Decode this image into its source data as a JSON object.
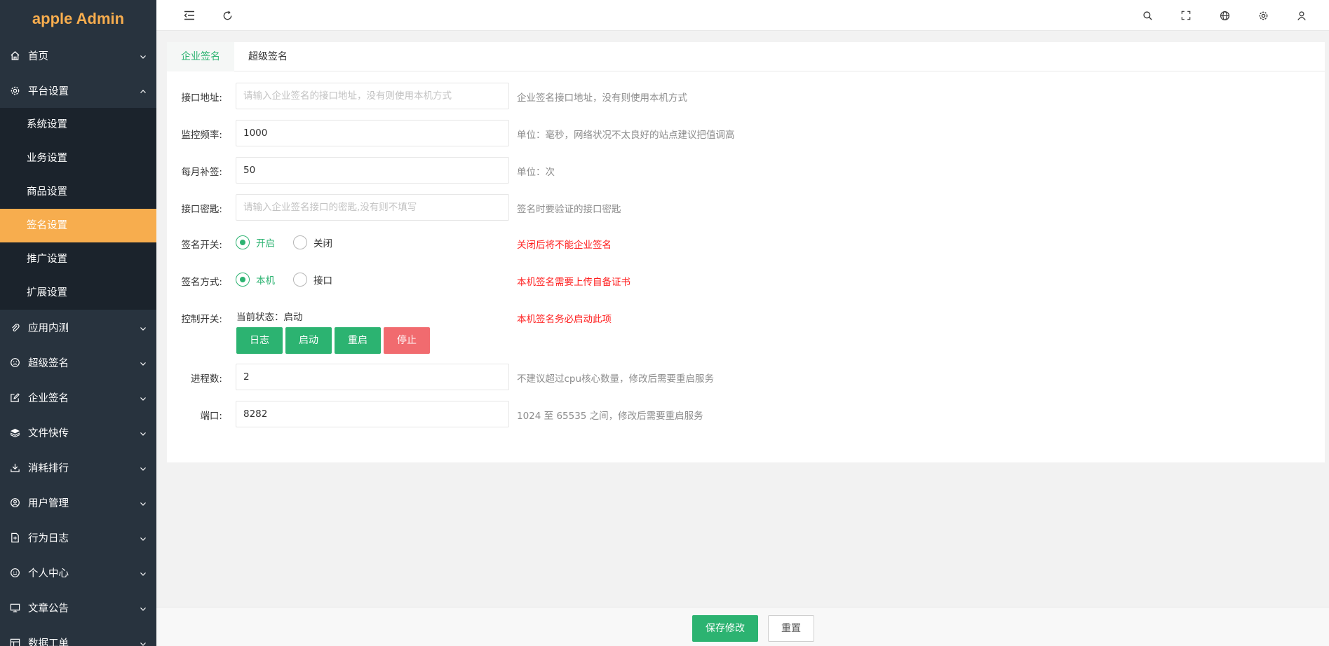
{
  "app": {
    "title": "apple Admin"
  },
  "sidebar": {
    "items": [
      {
        "label": "首页",
        "icon": "home-icon"
      },
      {
        "label": "平台设置",
        "icon": "gear-icon",
        "expanded": true,
        "children": [
          {
            "label": "系统设置"
          },
          {
            "label": "业务设置"
          },
          {
            "label": "商品设置"
          },
          {
            "label": "签名设置",
            "active": true
          },
          {
            "label": "推广设置"
          },
          {
            "label": "扩展设置"
          }
        ]
      },
      {
        "label": "应用内测",
        "icon": "paperclip-icon"
      },
      {
        "label": "超级签名",
        "icon": "face-icon"
      },
      {
        "label": "企业签名",
        "icon": "edit-icon"
      },
      {
        "label": "文件快传",
        "icon": "layers-icon"
      },
      {
        "label": "消耗排行",
        "icon": "download-icon"
      },
      {
        "label": "用户管理",
        "icon": "user-circle-icon"
      },
      {
        "label": "行为日志",
        "icon": "document-icon"
      },
      {
        "label": "个人中心",
        "icon": "smile-icon"
      },
      {
        "label": "文章公告",
        "icon": "monitor-icon"
      },
      {
        "label": "数据工单",
        "icon": "table-icon"
      }
    ]
  },
  "tabs": [
    {
      "label": "企业签名",
      "active": true
    },
    {
      "label": "超级签名"
    }
  ],
  "form": {
    "api_address": {
      "label": "接口地址:",
      "value": "",
      "placeholder": "请输入企业签名的接口地址，没有则使用本机方式",
      "help": "企业签名接口地址，没有则使用本机方式"
    },
    "monitor_freq": {
      "label": "监控频率:",
      "value": "1000",
      "help": "单位：毫秒，网络状况不太良好的站点建议把值调高"
    },
    "monthly_resign": {
      "label": "每月补签:",
      "value": "50",
      "help": "单位：次"
    },
    "api_key": {
      "label": "接口密匙:",
      "value": "",
      "placeholder": "请输入企业签名接口的密匙,没有则不填写",
      "help": "签名时要验证的接口密匙"
    },
    "sign_switch": {
      "label": "签名开关:",
      "on_label": "开启",
      "off_label": "关闭",
      "selected": "开启",
      "help": "关闭后将不能企业签名"
    },
    "sign_mode": {
      "label": "签名方式:",
      "local_label": "本机",
      "api_label": "接口",
      "selected": "本机",
      "help": "本机签名需要上传自备证书"
    },
    "control": {
      "label": "控制开关:",
      "status": "当前状态：启动",
      "buttons": [
        "日志",
        "启动",
        "重启",
        "停止"
      ],
      "help": "本机签名务必启动此项"
    },
    "processes": {
      "label": "进程数:",
      "value": "2",
      "help": "不建议超过cpu核心数量，修改后需要重启服务"
    },
    "port": {
      "label": "端口:",
      "value": "8282",
      "help": "1024 至 65535 之间，修改后需要重启服务"
    }
  },
  "footer": {
    "save_label": "保存修改",
    "reset_label": "重置"
  },
  "colors": {
    "accent": "#2cb371",
    "sidebar_bg": "#28333e",
    "active_item": "#f7ad4e",
    "danger": "#f16b6f",
    "hint_red": "#ff1f1f"
  }
}
